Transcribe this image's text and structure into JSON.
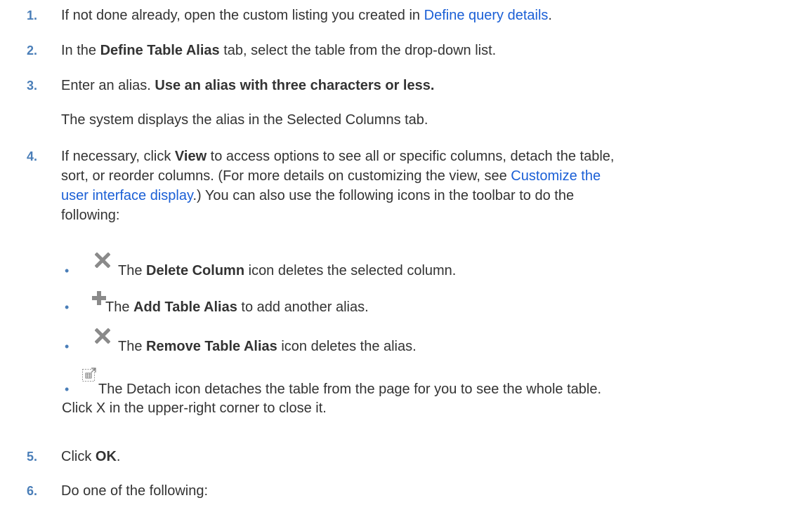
{
  "steps": [
    {
      "num": "1.",
      "pre": "If not done already, open the custom listing you created in ",
      "link": "Define query details",
      "post": "."
    },
    {
      "num": "2.",
      "pre": "In the ",
      "bold": "Define Table Alias",
      "post": " tab, select the table from the drop-down list."
    },
    {
      "num": "3.",
      "pre": "Enter an alias. ",
      "bold": "Use an alias with three characters or less."
    },
    {
      "note": "The system displays the alias in the Selected Columns tab."
    },
    {
      "num": "4.",
      "pre": "If necessary, click ",
      "bold": "View",
      "mid": " to access options to see all or specific columns, detach the table,",
      "line2_pre": "sort, or reorder columns. (For more details on customizing the view, see ",
      "link": "Customize the",
      "link2": "user interface display",
      "line3_post": ".) You can also use the following icons in the toolbar to do the",
      "line4": "following:"
    },
    {
      "num": "5.",
      "pre": "Click ",
      "bold": "OK",
      "post": "."
    },
    {
      "num": "6.",
      "pre": "Do one of the following:"
    }
  ],
  "bullets": [
    {
      "icon": "delete-column-x-icon",
      "pre": "The ",
      "bold": "Delete Column",
      "post": " icon deletes the selected column."
    },
    {
      "icon": "add-plus-icon",
      "pre": "The ",
      "bold": "Add Table Alias",
      "post": " to add another alias."
    },
    {
      "icon": "remove-alias-x-icon",
      "pre": "The ",
      "bold": "Remove Table Alias",
      "post": " icon deletes the alias."
    },
    {
      "icon": "detach-table-icon",
      "pre": "The Detach icon detaches the table from the page for you to see the whole table.",
      "line2": "Click X in the upper-right corner to close it."
    }
  ],
  "bullet_glyph": "•"
}
